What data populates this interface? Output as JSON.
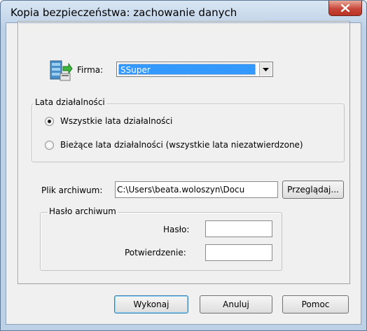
{
  "window": {
    "title": "Kopia bezpieczeństwa: zachowanie danych",
    "close_icon": "close-icon"
  },
  "company": {
    "label": "Firma:",
    "value": "SSuper",
    "icon": "database-archive-icon"
  },
  "years_group": {
    "title": "Lata działalności",
    "options": [
      {
        "label": "Wszystkie lata działalności",
        "selected": true
      },
      {
        "label": "Bieżące lata działalności (wszystkie lata niezatwierdzone)",
        "selected": false
      }
    ]
  },
  "archive": {
    "label": "Plik archiwum:",
    "value": "C:\\Users\\beata.woloszyn\\Docu",
    "browse_label": "Przeglądaj..."
  },
  "password_group": {
    "title": "Hasło archiwum",
    "password_label": "Hasło:",
    "password_value": "",
    "confirm_label": "Potwierdzenie:",
    "confirm_value": ""
  },
  "buttons": {
    "execute": "Wykonaj",
    "cancel": "Anuluj",
    "help": "Pomoc"
  },
  "colors": {
    "selection": "#3399ff",
    "close": "#c8473a",
    "frame": "#bcd0e6"
  }
}
